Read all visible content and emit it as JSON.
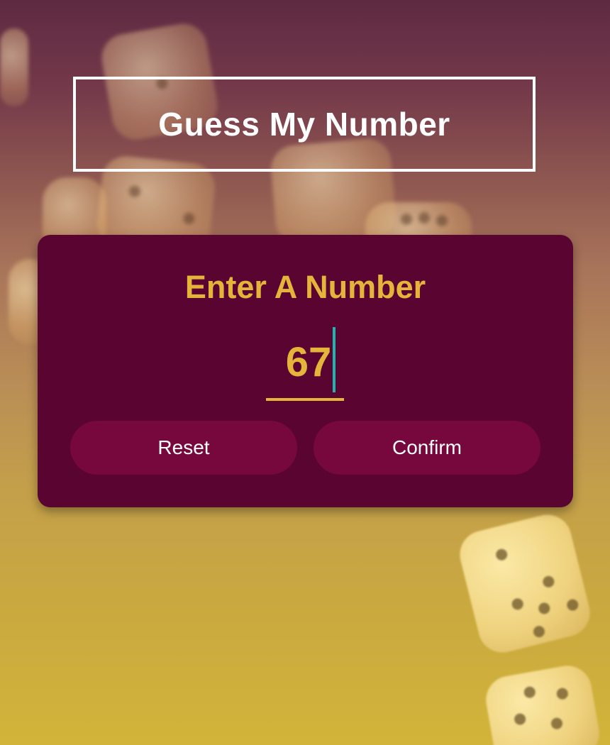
{
  "app": {
    "title": "Guess My Number"
  },
  "card": {
    "label": "Enter A Number",
    "input_value": "67"
  },
  "buttons": {
    "reset_label": "Reset",
    "confirm_label": "Confirm"
  },
  "colors": {
    "accent": "#e4b53a",
    "card_background": "#590431",
    "button_background": "#76083e",
    "caret": "#1fb6b0",
    "title_text": "#ffffff"
  },
  "background": {
    "image": "dice-background"
  }
}
